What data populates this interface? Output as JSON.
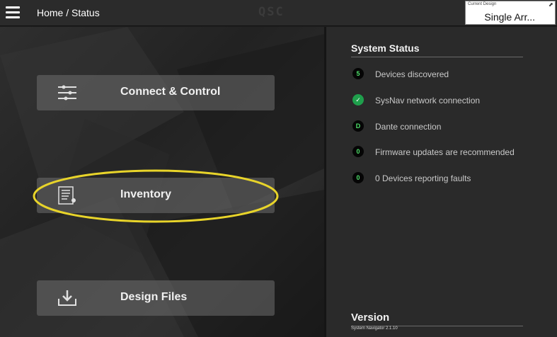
{
  "header": {
    "breadcrumb": "Home / Status",
    "logo": "QSC",
    "current_design_caption": "Current Design",
    "current_design_value": "Single Arr...",
    "menu_icon": "hamburger-menu-icon",
    "expand_icon": "expand-icon"
  },
  "tiles": [
    {
      "label": "Connect & Control",
      "icon": "sliders-icon"
    },
    {
      "label": "Inventory",
      "icon": "inventory-list-icon"
    },
    {
      "label": "Design Files",
      "icon": "download-tray-icon"
    }
  ],
  "system_status": {
    "title": "System Status",
    "items": [
      {
        "badge": "5",
        "text": "Devices discovered"
      },
      {
        "badge": "✓",
        "text": "SysNav network connection"
      },
      {
        "badge": "D",
        "text": "Dante connection"
      },
      {
        "badge": "0",
        "text": "Firmware updates are recommended"
      },
      {
        "badge": "0",
        "text": "0 Devices reporting faults"
      }
    ]
  },
  "version": {
    "title": "Version",
    "text": "System Navigator 2.1.10"
  },
  "colors": {
    "highlight": "#e8d42a",
    "ok_badge": "#1f9f4c",
    "badge_text": "#4ee06a"
  }
}
